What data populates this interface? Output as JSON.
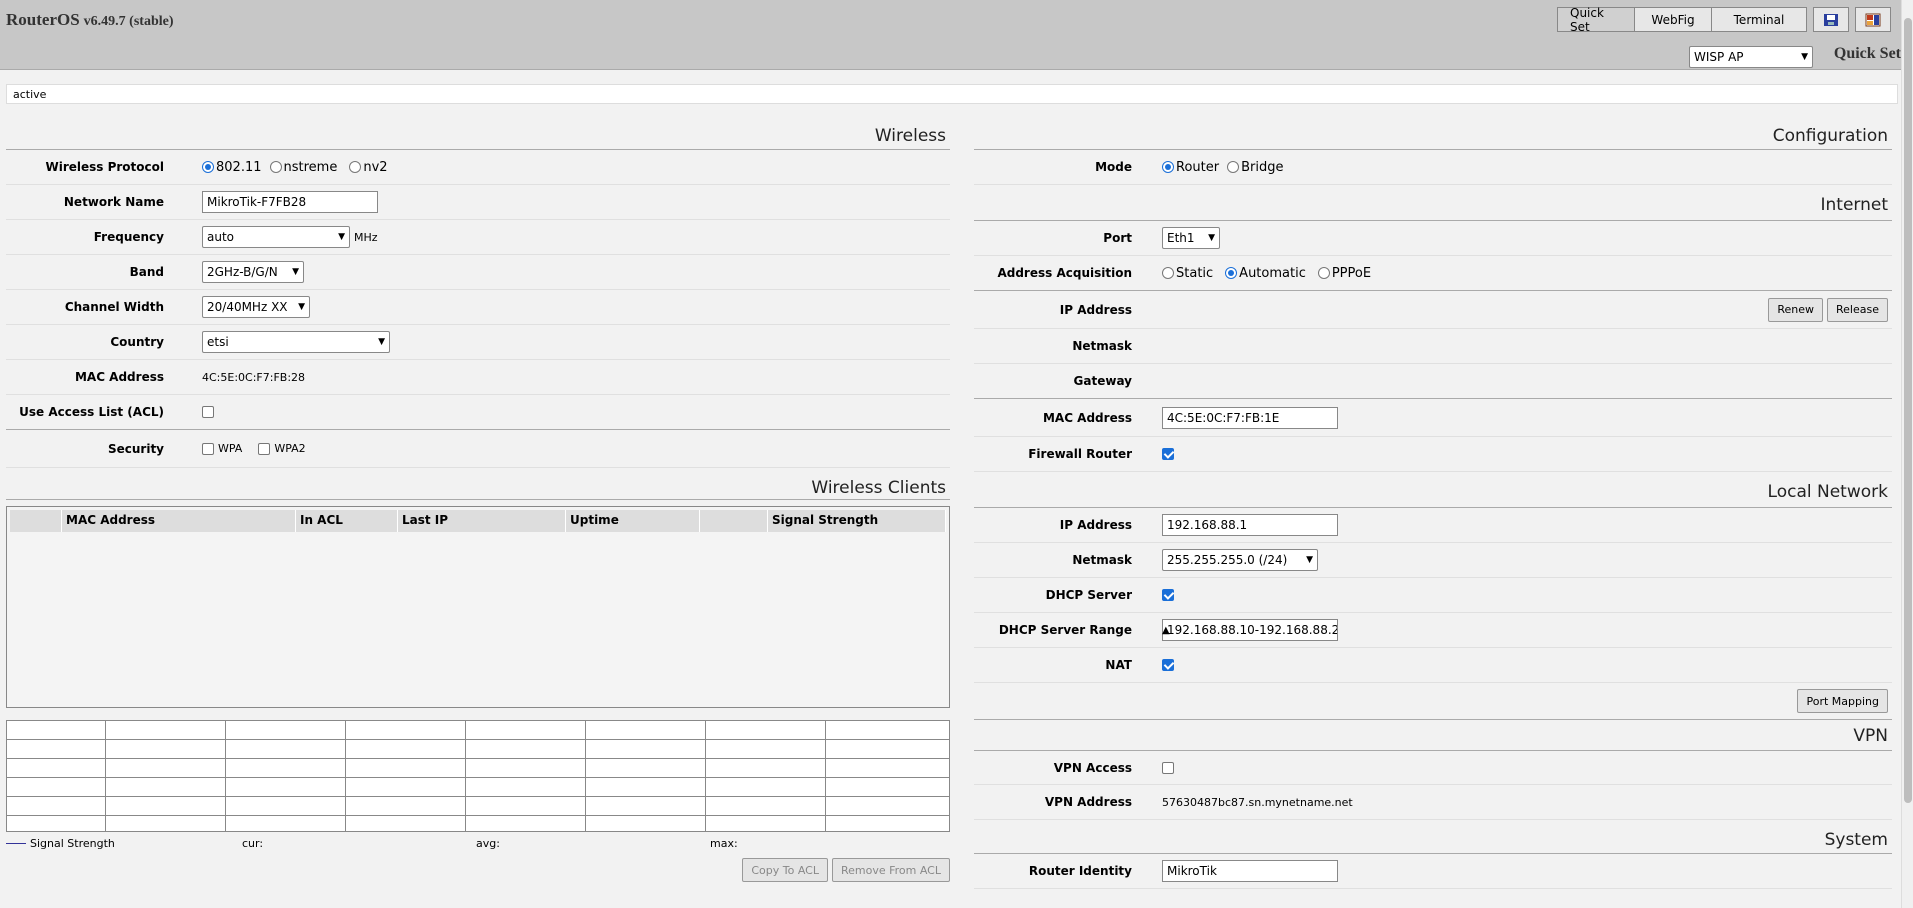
{
  "header": {
    "logo": "RouterOS",
    "version": "v6.49.7 (stable)",
    "buttons": [
      "Quick Set",
      "WebFig",
      "Terminal"
    ],
    "mode_select": "WISP AP",
    "page_title": "Quick Set"
  },
  "status": "active",
  "wireless": {
    "title": "Wireless",
    "protocol_label": "Wireless Protocol",
    "protocol_options": [
      "802.11",
      "nstreme",
      "nv2"
    ],
    "network_name_label": "Network Name",
    "network_name": "MikroTik-F7FB28",
    "frequency_label": "Frequency",
    "frequency": "auto",
    "frequency_unit": "MHz",
    "band_label": "Band",
    "band": "2GHz-B/G/N",
    "channel_width_label": "Channel Width",
    "channel_width": "20/40MHz XX",
    "country_label": "Country",
    "country": "etsi",
    "mac_label": "MAC Address",
    "mac": "4C:5E:0C:F7:FB:28",
    "acl_label": "Use Access List (ACL)",
    "security_label": "Security",
    "security_wpa": "WPA",
    "security_wpa2": "WPA2"
  },
  "clients": {
    "title": "Wireless Clients",
    "columns": [
      "",
      "MAC Address",
      "In ACL",
      "Last IP",
      "Uptime",
      "",
      "Signal Strength"
    ],
    "legend": "Signal Strength",
    "cur": "cur:",
    "avg": "avg:",
    "max": "max:",
    "copy_btn": "Copy To ACL",
    "remove_btn": "Remove From ACL"
  },
  "configuration": {
    "title": "Configuration",
    "mode_label": "Mode",
    "mode_router": "Router",
    "mode_bridge": "Bridge"
  },
  "internet": {
    "title": "Internet",
    "port_label": "Port",
    "port": "Eth1",
    "acq_label": "Address Acquisition",
    "acq_static": "Static",
    "acq_automatic": "Automatic",
    "acq_pppoe": "PPPoE",
    "ip_label": "IP Address",
    "renew": "Renew",
    "release": "Release",
    "netmask_label": "Netmask",
    "gateway_label": "Gateway",
    "mac_label": "MAC Address",
    "mac": "4C:5E:0C:F7:FB:1E",
    "firewall_label": "Firewall Router"
  },
  "local": {
    "title": "Local Network",
    "ip_label": "IP Address",
    "ip": "192.168.88.1",
    "netmask_label": "Netmask",
    "netmask": "255.255.255.0 (/24)",
    "dhcp_label": "DHCP Server",
    "range_label": "DHCP Server Range",
    "range": "192.168.88.10-192.168.88.2",
    "nat_label": "NAT",
    "port_mapping": "Port Mapping"
  },
  "vpn": {
    "title": "VPN",
    "access_label": "VPN Access",
    "address_label": "VPN Address",
    "address": "57630487bc87.sn.mynetname.net"
  },
  "system": {
    "title": "System",
    "identity_label": "Router Identity",
    "identity": "MikroTik"
  }
}
